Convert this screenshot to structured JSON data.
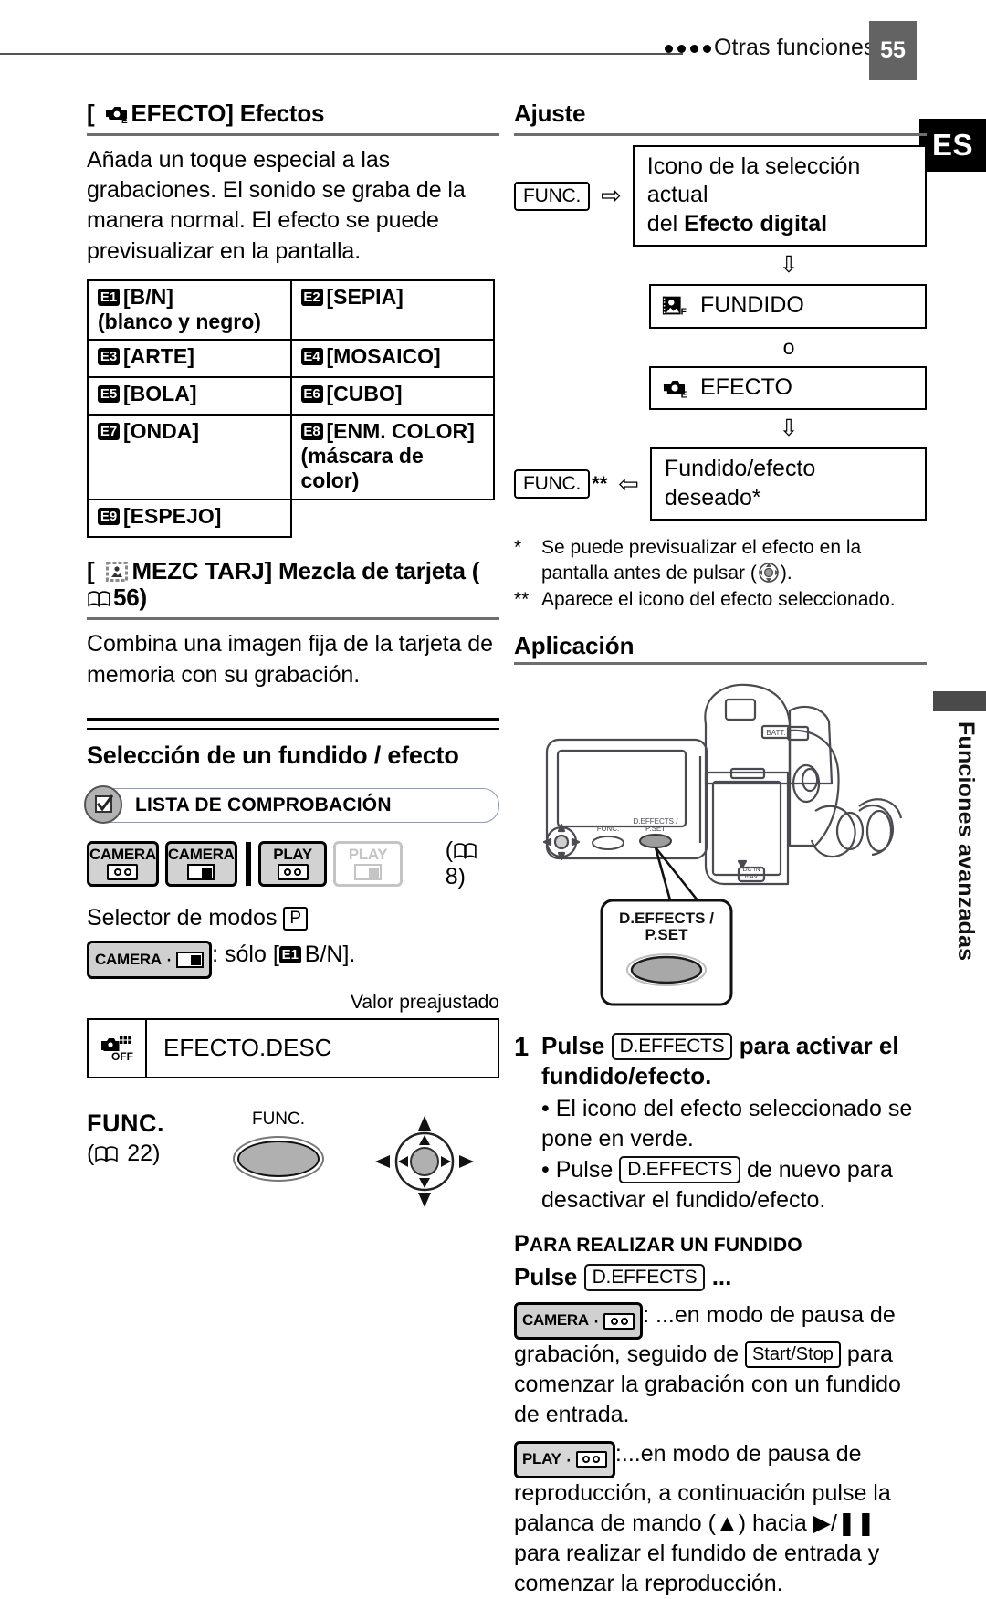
{
  "header": {
    "title": "Otras funciones",
    "page_number": "55",
    "lang_badge": "ES",
    "side_tab": "Funciones avanzadas"
  },
  "left": {
    "effect_heading_prefix": "[",
    "effect_heading_icon": "effect-icon",
    "effect_heading": "EFECTO] Efectos",
    "effect_body": "Añada un toque especial a las grabaciones. El sonido se graba de la manera normal. El efecto se puede previsualizar en la pantalla.",
    "effects_table": [
      [
        {
          "badge": "E1",
          "label": "[B/N]",
          "sub": "(blanco y negro)"
        },
        {
          "badge": "E2",
          "label": "[SEPIA]",
          "sub": ""
        }
      ],
      [
        {
          "badge": "E3",
          "label": "[ARTE]",
          "sub": ""
        },
        {
          "badge": "E4",
          "label": "[MOSAICO]",
          "sub": ""
        }
      ],
      [
        {
          "badge": "E5",
          "label": "[BOLA]",
          "sub": ""
        },
        {
          "badge": "E6",
          "label": "[CUBO]",
          "sub": ""
        }
      ],
      [
        {
          "badge": "E7",
          "label": "[ONDA]",
          "sub": ""
        },
        {
          "badge": "E8",
          "label": "[ENM. COLOR]",
          "sub": "(máscara de color)"
        }
      ],
      [
        {
          "badge": "E9",
          "label": "[ESPEJO]",
          "sub": ""
        },
        {
          "badge": "",
          "label": "",
          "sub": ""
        }
      ]
    ],
    "cardmix_heading_open": "[",
    "cardmix_heading_icon": "card-mix-icon",
    "cardmix_heading": "MEZC TARJ] Mezcla de tarjeta (",
    "cardmix_page": "56",
    "cardmix_heading_close": ")",
    "cardmix_body": "Combina una imagen fija de la tarjeta de memoria con su grabación.",
    "selection_heading": "Selección de un fundido / efecto",
    "checklist_label": "LISTA DE COMPROBACIÓN",
    "modes": [
      {
        "name": "CAMERA",
        "media": "tape",
        "enabled": true
      },
      {
        "name": "CAMERA",
        "media": "card",
        "enabled": true
      },
      {
        "name": "PLAY",
        "media": "tape",
        "enabled": true
      },
      {
        "name": "PLAY",
        "media": "card",
        "enabled": false
      }
    ],
    "modes_page_ref": "8",
    "mode_selector_text": "Selector de modos",
    "mode_selector_key": "P",
    "mode_only_prefix": "CAMERA",
    "mode_only_text": ": sólo [",
    "mode_only_badge": "E1",
    "mode_only_suffix": "B/N].",
    "preset_label": "Valor preajustado",
    "preset_icon": "effect-off-icon",
    "preset_value": "EFECTO.DESC",
    "func_title": "FUNC.",
    "func_page_ref": "22",
    "func_button_label": "FUNC."
  },
  "right": {
    "setup_heading": "Ajuste",
    "func_tag": "FUNC.",
    "flow_step1_line1": "Icono de la selección actual",
    "flow_step1_line2_prefix": "del ",
    "flow_step1_line2_bold": "Efecto digital",
    "flow_fundido": "FUNDIDO",
    "flow_or": "o",
    "flow_efecto": "EFECTO",
    "flow_final": "Fundido/efecto deseado*",
    "func_tag2": "FUNC.",
    "func_tag2_stars": "**",
    "note1_mark": "*",
    "note1_a": "Se puede previsualizar el efecto en la",
    "note1_b": "pantalla antes de pulsar (",
    "note1_c": ").",
    "note2_mark": "**",
    "note2": "Aparece el icono del efecto seleccionado.",
    "application_heading": "Aplicación",
    "figure_callout_line1": "D.EFFECTS /",
    "figure_callout_line2": "P.SET",
    "figure_button_func": "FUNC.",
    "figure_button_deffects_1": "D.EFFECTS /",
    "figure_button_deffects_2": "P.SET",
    "figure_batt_label": "BATT.",
    "figure_dcin_1": "DC IN",
    "figure_dcin_2": "6.4V",
    "step_number": "1",
    "step_text_a": "Pulse ",
    "step_key": "D.EFFECTS",
    "step_text_b": " para activar el fundido/efecto.",
    "bullet1": "• El icono del efecto seleccionado se pone en verde.",
    "bullet2_a": "• Pulse ",
    "bullet2_key": "D.EFFECTS",
    "bullet2_b": " de nuevo para desactivar el fundido/efecto.",
    "subheading_first": "P",
    "subheading_rest": "ARA REALIZAR UN FUNDIDO",
    "pulse_label": "Pulse ",
    "pulse_key": "D.EFFECTS",
    "pulse_dots": " ...",
    "para1_badge": "CAMERA",
    "para1_a": ": ...en modo de pausa de grabación, seguido de ",
    "para1_key": "Start/Stop",
    "para1_b": " para comenzar la grabación con un fundido de entrada.",
    "para2_badge": "PLAY",
    "para2_a": ":...en modo de pausa de reproducción, a continuación pulse la palanca de mando (",
    "para2_up": "▲",
    "para2_b": ") hacia ",
    "para2_play": "▶/❚❚",
    "para2_c": " para realizar el fundido de entrada y comenzar la reproducción."
  },
  "colors": {
    "page_number_bg": "#636363",
    "badge_bg": "#000000",
    "mode_badge_bg": "#d2d2d2",
    "mode_disabled": "#c4c4c4",
    "rule": "#6e6e6e",
    "checklist_border": "#8d9bb5"
  }
}
